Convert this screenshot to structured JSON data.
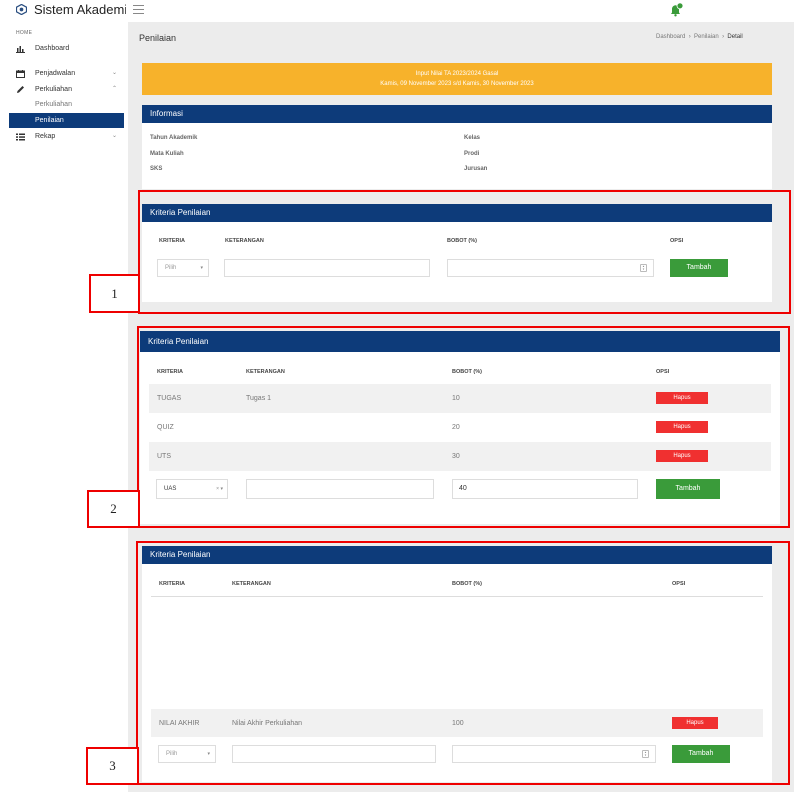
{
  "app": {
    "title": "Sistem Akademik"
  },
  "sidebar": {
    "section": "HOME",
    "items": [
      {
        "label": "Dashboard",
        "icon": "bar-chart-icon"
      },
      {
        "label": "Penjadwalan",
        "icon": "calendar-icon"
      },
      {
        "label": "Perkuliahan",
        "icon": "pencil-icon"
      },
      {
        "label": "Rekap",
        "icon": "list-icon"
      }
    ],
    "subitems": [
      "Perkuliahan",
      "Penilaian"
    ]
  },
  "page": {
    "title": "Penilaian",
    "breadcrumb": [
      "Dashboard",
      "Penilaian",
      "Detail"
    ]
  },
  "alert": {
    "line1": "Input Nilai TA 2023/2024 Gasal",
    "line2": "Kamis, 09 November 2023 s/d Kamis, 30 November 2023"
  },
  "info": {
    "title": "Informasi",
    "left": [
      "Tahun Akademik",
      "Mata Kuliah",
      "SKS"
    ],
    "right": [
      "Kelas",
      "Prodi",
      "Jurusan"
    ]
  },
  "kriteria": {
    "title": "Kriteria Penilaian",
    "columns": [
      "KRITERIA",
      "KETERANGAN",
      "BOBOT (%)",
      "OPSI"
    ],
    "select_placeholder": "Pilih",
    "add_button": "Tambah",
    "delete_button": "Hapus"
  },
  "panel2": {
    "rows": [
      {
        "kriteria": "TUGAS",
        "keterangan": "Tugas 1",
        "bobot": "10"
      },
      {
        "kriteria": "QUIZ",
        "keterangan": "",
        "bobot": "20"
      },
      {
        "kriteria": "UTS",
        "keterangan": "",
        "bobot": "30"
      }
    ],
    "input_select": "UAS",
    "input_bobot": "40"
  },
  "panel3": {
    "rows": [
      {
        "kriteria": "NILAI AKHIR",
        "keterangan": "Nilai Akhir Perkuliahan",
        "bobot": "100"
      }
    ]
  },
  "labels": [
    "1",
    "2",
    "3"
  ],
  "colors": {
    "primary": "#0d3b7a",
    "alert": "#f7b22b",
    "success": "#3a9b3a",
    "danger": "#f03030",
    "annotation": "#e00000"
  }
}
